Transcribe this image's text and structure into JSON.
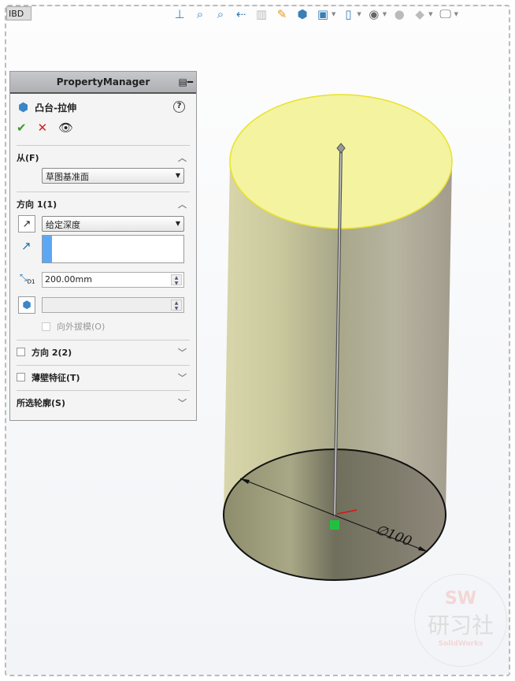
{
  "window": {
    "tab_label": "IBD"
  },
  "toolbar": {
    "icons": [
      "normal-to-icon",
      "zoom-to-fit-icon",
      "zoom-to-area-icon",
      "previous-view-icon",
      "section-view-icon",
      "dynamic-annotation-icon",
      "view-orientation-icon",
      "display-style-icon",
      "hide-show-icon",
      "edit-appearance-icon",
      "apply-scene-icon",
      "view-settings-icon"
    ]
  },
  "property_manager": {
    "header": "PropertyManager",
    "feature_title": "凸台-拉伸",
    "from": {
      "label": "从(F)",
      "value": "草图基准面"
    },
    "direction1": {
      "label": "方向 1(1)",
      "end_condition": "给定深度",
      "depth": "200.00mm",
      "draft_outward": "向外拔模(O)"
    },
    "direction2": {
      "label": "方向 2(2)"
    },
    "thin_feature": {
      "label": "薄壁特征(T)"
    },
    "selected_contours": {
      "label": "所选轮廓(S)"
    }
  },
  "viewport": {
    "dimension": "∅100",
    "colors": {
      "top_face": "#f4f3a0",
      "side": "#c8c69a"
    }
  },
  "watermark": {
    "line1": "SW",
    "line2": "研习社",
    "line3": "SolidWorks"
  }
}
